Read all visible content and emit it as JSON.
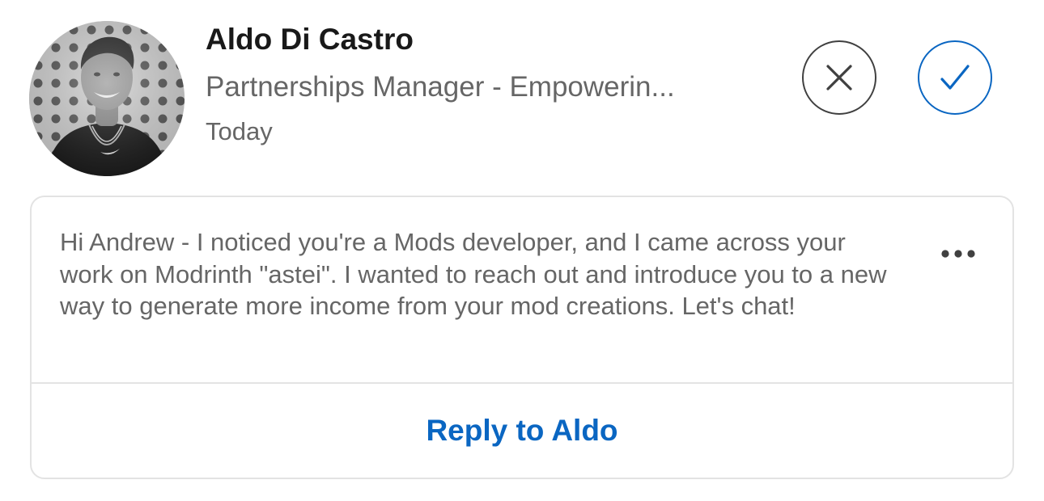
{
  "invitation": {
    "sender": {
      "name": "Aldo Di Castro",
      "headline": "Partnerships Manager - Empowerin...",
      "timestamp": "Today"
    },
    "actions": {
      "ignore_icon": "close-icon",
      "accept_icon": "checkmark-icon"
    },
    "message": {
      "text": "Hi Andrew - I noticed you're a Mods developer, and I came across your work on Modrinth \"astei\". I wanted to reach out and introduce you to a new way to generate more income from your mod creations. Let's chat!",
      "more_icon": "more-options-icon"
    },
    "reply": {
      "label": "Reply to Aldo"
    }
  },
  "colors": {
    "accent": "#0a66c2",
    "text_primary": "#191919",
    "text_secondary": "#666666",
    "border": "#e3e3e3"
  }
}
